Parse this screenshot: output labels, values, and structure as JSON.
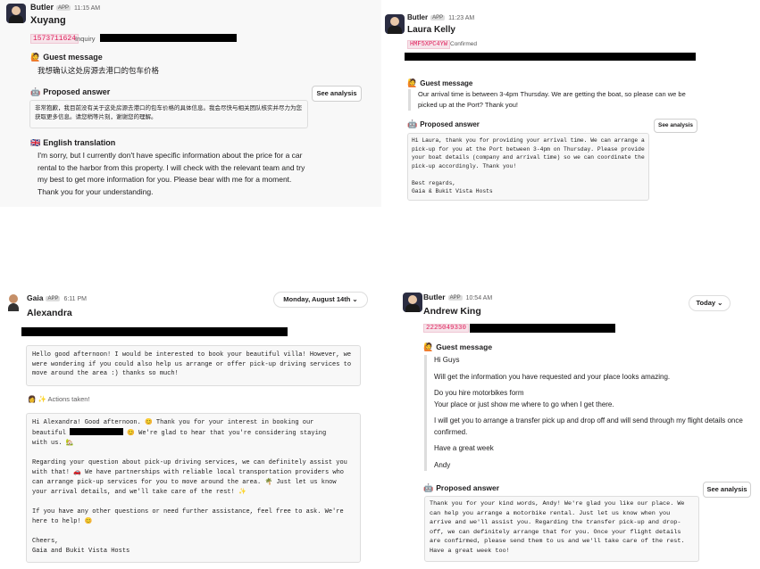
{
  "p1": {
    "sender": "Butler",
    "app_badge": "APP",
    "time": "11:15 AM",
    "guest_name": "Xuyang",
    "code": "1573711624",
    "code_status": "Inquiry",
    "guest_message_title": "Guest message",
    "guest_message": "我想确认这处房源去港口的包车价格",
    "proposed_title": "Proposed answer",
    "proposed_answer": "非常抱歉，我目前没有关于这处房源去港口的包车价格的具体信息。我会尽快与相关团队核实并尽力为您获取更多信息。请您稍等片刻，谢谢您的理解。",
    "see_analysis": "See analysis",
    "translation_title": "English translation",
    "translation": "I'm sorry, but I currently don't have specific information about the price for a car rental to the harbor from this property. I will check with the relevant team and try my best to get more information for you. Please bear with me for a moment. Thank you for your understanding."
  },
  "p2": {
    "sender": "Butler",
    "app_badge": "APP",
    "time": "11:23 AM",
    "guest_name": "Laura Kelly",
    "code": "HMF5XPC4YW",
    "code_status": "Confirmed",
    "guest_message_title": "Guest message",
    "guest_message": "Our arrival time is between 3-4pm Thursday. We are getting the boat, so please can we be picked up at the Port? Thank you!",
    "proposed_title": "Proposed answer",
    "see_analysis": "See analysis",
    "proposed_answer": "Hi Laura, thank you for providing your arrival time. We can arrange a pick-up for you at the Port between 3-4pm on Thursday. Please provide your boat details (company and arrival time) so we can coordinate the pick-up accordingly. Thank you!\n\nBest regards,\nGaia & Bukit Vista Hosts"
  },
  "p3": {
    "sender": "Gaia",
    "app_badge": "APP",
    "time": "6:11 PM",
    "date_pill": "Monday, August 14th",
    "guest_name": "Alexandra",
    "guest_message": "Hello good afternoon! I would be interested to book your beautiful villa! However, we were wondering if you could also help us arrange or offer pick-up driving services to move around the area :) thanks so much!",
    "actions_taken": "✨ Actions taken!",
    "reply_line1": "Hi Alexandra! Good afternoon. 😊 Thank you for your interest in booking our",
    "reply_line2_a": "beautiful",
    "reply_line2_b": "😊 We're glad to hear that you're considering staying",
    "reply_line3": "with us. 🏡",
    "reply_para2": "Regarding your question about pick-up driving services, we can definitely assist you with that! 🚗 We have partnerships with reliable local transportation providers who can arrange pick-up services for you to move around the area. 🌴 Just let us know your arrival details, and we'll take care of the rest! ✨",
    "reply_para3": "If you have any other questions or need further assistance, feel free to ask. We're here to help! 😊",
    "reply_sign": "Cheers,\nGaia and Bukit Vista Hosts"
  },
  "p4": {
    "sender": "Butler",
    "app_badge": "APP",
    "time": "10:54 AM",
    "today_pill": "Today",
    "guest_name": "Andrew King",
    "code": "2225049330",
    "guest_message_title": "Guest message",
    "msg_lines": [
      "Hi Guys",
      "Will get the information you have requested and your place looks amazing.",
      "Do you hire motorbikes form",
      "Your place or just show me where to go when I get there.",
      "I will get you to arrange a transfer pick up and drop off and will send through my flight details once confirmed.",
      "Have a great week",
      "Andy"
    ],
    "proposed_title": "Proposed answer",
    "see_analysis": "See analysis",
    "proposed_answer": "Thank you for your kind words, Andy! We're glad you like our place. We can help you arrange a motorbike rental. Just let us know when you arrive and we'll assist you. Regarding the transfer pick-up and drop-off, we can definitely arrange that for you. Once your flight details are confirmed, please send them to us and we'll take care of the rest. Have a great week too!"
  }
}
